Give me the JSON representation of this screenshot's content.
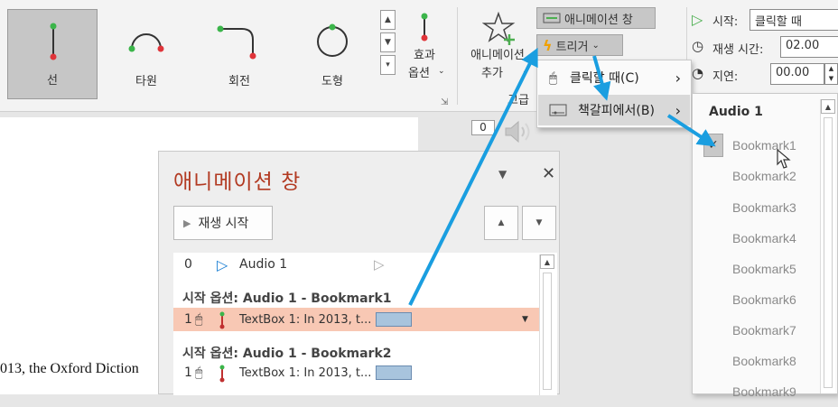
{
  "ribbon": {
    "gallery": [
      {
        "label": "선",
        "selected": true
      },
      {
        "label": "타원",
        "selected": false
      },
      {
        "label": "회전",
        "selected": false
      },
      {
        "label": "도형",
        "selected": false
      }
    ],
    "effect_options": {
      "line1": "효과",
      "line2": "옵션"
    },
    "add_animation": {
      "line1": "애니메이션",
      "line2": "추가"
    },
    "advanced_partial": "고급",
    "animation_pane_btn": "애니메이션 창",
    "trigger_btn": "트리거",
    "start_label": "시작:",
    "start_value": "클릭할 때",
    "duration_label": "재생 시간:",
    "duration_value": "02.00",
    "delay_label": "지연:",
    "delay_value": "00.00"
  },
  "slide": {
    "audio_counter": "0",
    "body_text": "013, the Oxford Diction"
  },
  "pane": {
    "title": "애니메이션 창",
    "play_label": "재생 시작",
    "items": {
      "audio_index": "0",
      "audio_name": "Audio 1",
      "header1": "시작 옵션: Audio 1 - Bookmark1",
      "row1_num": "1",
      "row1_text": "TextBox 1: In 2013, t...",
      "header2": "시작 옵션: Audio 1 - Bookmark2",
      "row2_num": "1",
      "row2_text": "TextBox 1: In 2013, t..."
    }
  },
  "trigger_menu": {
    "on_click": "클릭할 때(C)",
    "on_bookmark": "책갈피에서(B)"
  },
  "bookmark_menu": {
    "header": "Audio 1",
    "items": [
      "Bookmark1",
      "Bookmark2",
      "Bookmark3",
      "Bookmark4",
      "Bookmark5",
      "Bookmark6",
      "Bookmark7",
      "Bookmark8",
      "Bookmark9"
    ],
    "checked_index": 0
  },
  "colors": {
    "pane_title": "#b23a22",
    "selected_row": "#f8c8b4",
    "callout_arrow": "#1a9ee0",
    "trigger_icon": "#f0a000",
    "accent_green": "#4caf50"
  }
}
